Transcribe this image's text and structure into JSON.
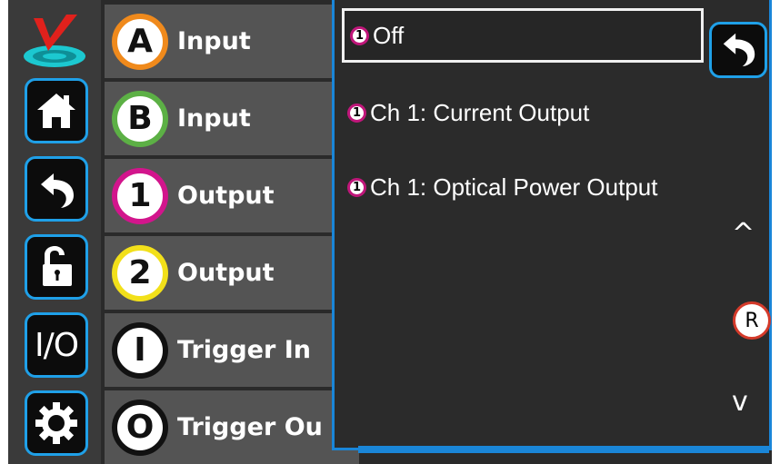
{
  "sidebar": {
    "logo_icon": "v-logo-icon",
    "buttons": [
      {
        "name": "home-button",
        "icon": "home-icon"
      },
      {
        "name": "back-button",
        "icon": "back-arrow-icon"
      },
      {
        "name": "lock-button",
        "icon": "unlocked-padlock-icon"
      },
      {
        "name": "io-button",
        "label": "I/O"
      },
      {
        "name": "settings-button",
        "icon": "gear-icon"
      }
    ]
  },
  "channels": [
    {
      "badge": "A",
      "label": "Input",
      "color": "#f08a1c"
    },
    {
      "badge": "B",
      "label": "Input",
      "color": "#5cb045"
    },
    {
      "badge": "1",
      "label": "Output",
      "color": "#d2158c"
    },
    {
      "badge": "2",
      "label": "Output",
      "color": "#f2e01a"
    },
    {
      "badge": "I",
      "label": "Trigger In",
      "color": "#111111"
    },
    {
      "badge": "O",
      "label": "Trigger Ou",
      "color": "#111111"
    }
  ],
  "dropdown": {
    "options": [
      {
        "badge": "1",
        "label": "Off",
        "selected": true
      },
      {
        "badge": "1",
        "label": "Ch 1: Current Output",
        "selected": false
      },
      {
        "badge": "1",
        "label": "Ch 1: Optical Power Output",
        "selected": false
      }
    ],
    "back_icon": "back-arrow-icon",
    "scroll_up": "^",
    "scroll_down": "v",
    "reset_label": "R"
  },
  "colors": {
    "accent": "#1a86d8",
    "panel": "#2b2b2b",
    "row": "#545454"
  }
}
